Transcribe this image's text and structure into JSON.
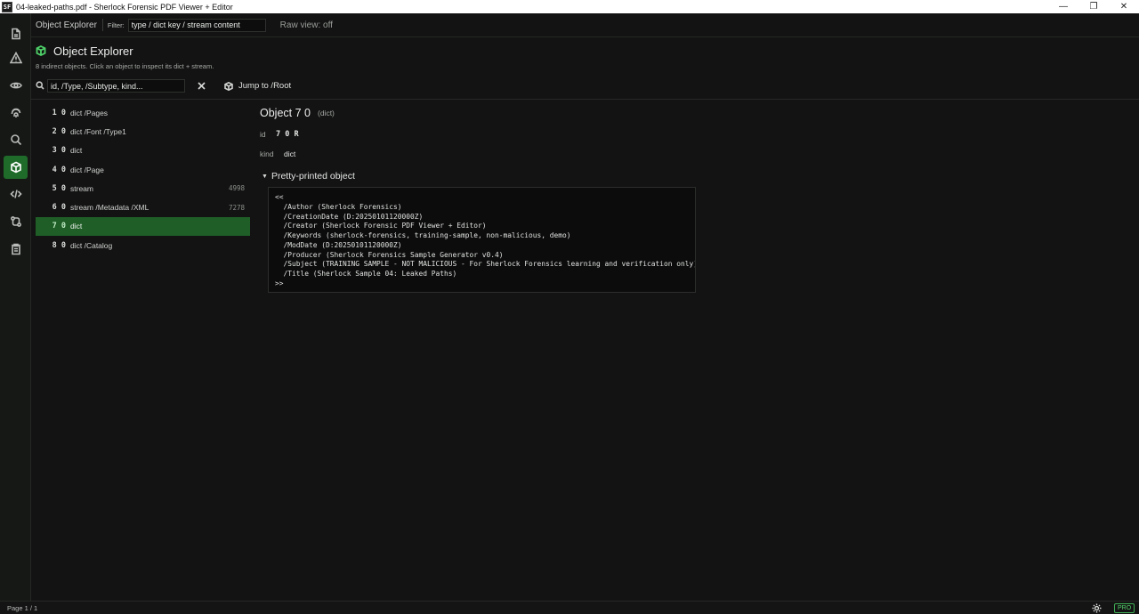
{
  "window": {
    "app_icon_text": "SF",
    "title": "04-leaked-paths.pdf - Sherlock Forensic PDF Viewer + Editor",
    "controls": {
      "minimize": "—",
      "maximize": "❐",
      "close": "✕"
    }
  },
  "rail": {
    "items": [
      {
        "name": "document",
        "active": false
      },
      {
        "name": "warning",
        "active": false
      },
      {
        "name": "eye",
        "active": false
      },
      {
        "name": "fingerprint",
        "active": false
      },
      {
        "name": "search",
        "active": false
      },
      {
        "name": "cube",
        "active": true
      },
      {
        "name": "code",
        "active": false
      },
      {
        "name": "git-compare",
        "active": false
      },
      {
        "name": "clipboard",
        "active": false
      }
    ]
  },
  "toolbar": {
    "title": "Object Explorer",
    "filter_label": "Filter:",
    "filter_value": "type / dict key / stream content",
    "raw_view": "Raw view: off"
  },
  "header": {
    "title": "Object Explorer",
    "subtitle": "8 indirect objects. Click an object to inspect its dict + stream."
  },
  "search": {
    "placeholder": "id, /Type, /Subtype, kind...",
    "jump_label": "Jump to /Root"
  },
  "objects": [
    {
      "id": "1 0",
      "kind": "dict /Pages",
      "size": "",
      "selected": false
    },
    {
      "id": "2 0",
      "kind": "dict /Font /Type1",
      "size": "",
      "selected": false
    },
    {
      "id": "3 0",
      "kind": "dict",
      "size": "",
      "selected": false
    },
    {
      "id": "4 0",
      "kind": "dict /Page",
      "size": "",
      "selected": false
    },
    {
      "id": "5 0",
      "kind": "stream",
      "size": "4998",
      "selected": false
    },
    {
      "id": "6 0",
      "kind": "stream /Metadata /XML",
      "size": "7278",
      "selected": false
    },
    {
      "id": "7 0",
      "kind": "dict",
      "size": "",
      "selected": true
    },
    {
      "id": "8 0",
      "kind": "dict /Catalog",
      "size": "",
      "selected": false
    }
  ],
  "detail": {
    "title": "Object 7 0",
    "kind_tag": "(dict)",
    "id_label": "id",
    "id_value": "7 0 R",
    "kind_label": "kind",
    "kind_value": "dict",
    "section_caret": "▼",
    "section_label": "Pretty-printed object",
    "pretty_printed": "<<\n  /Author (Sherlock Forensics)\n  /CreationDate (D:20250101120000Z)\n  /Creator (Sherlock Forensic PDF Viewer + Editor)\n  /Keywords (sherlock-forensics, training-sample, non-malicious, demo)\n  /ModDate (D:20250101120000Z)\n  /Producer (Sherlock Forensics Sample Generator v0.4)\n  /Subject (TRAINING SAMPLE - NOT MALICIOUS - For Sherlock Forensics learning and verification only)\n  /Title (Sherlock Sample 04: Leaked Paths)\n>>"
  },
  "status": {
    "page": "Page 1 / 1",
    "badge": "PRO"
  },
  "colors": {
    "accent": "#1f6b2a",
    "accent_bright": "#4fd16a",
    "background": "#121312"
  }
}
